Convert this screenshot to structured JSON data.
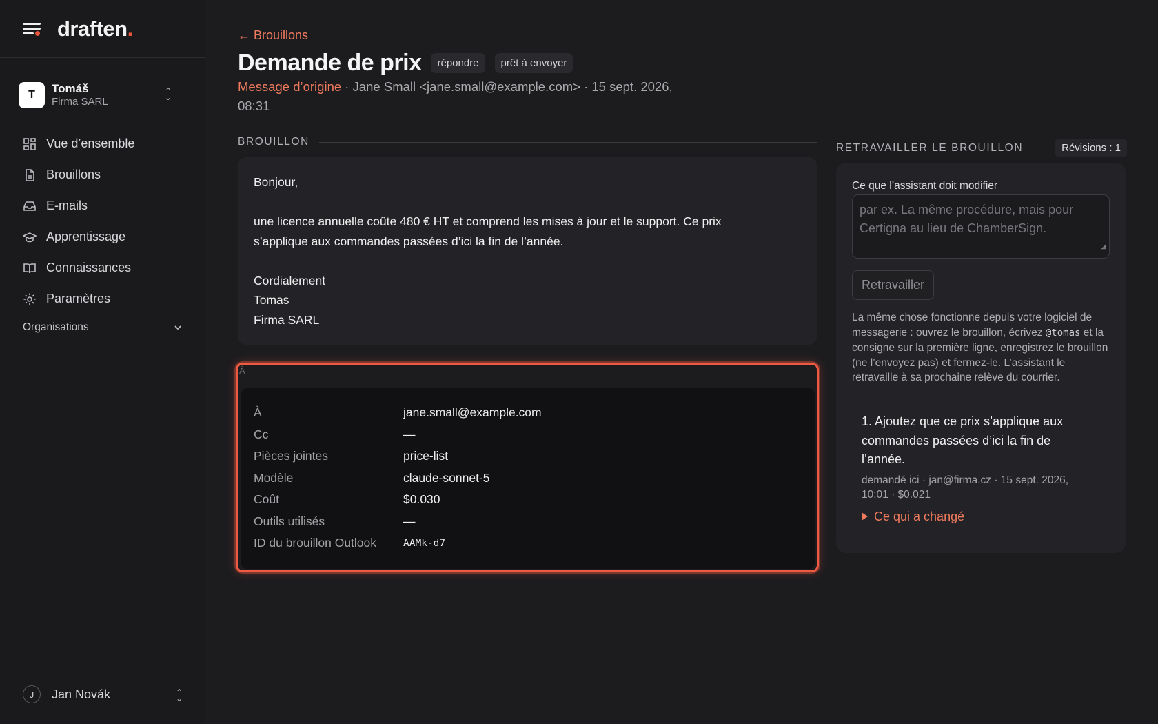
{
  "brand": {
    "logo_text": "draften",
    "logo_dot": "."
  },
  "org": {
    "initial": "T",
    "name": "Tomáš",
    "company": "Firma SARL"
  },
  "nav": [
    {
      "label": "Vue d’ensemble",
      "icon": "grid-icon"
    },
    {
      "label": "Brouillons",
      "icon": "document-icon"
    },
    {
      "label": "E-mails",
      "icon": "inbox-icon"
    },
    {
      "label": "Apprentissage",
      "icon": "graduation-cap-icon"
    },
    {
      "label": "Connaissances",
      "icon": "book-icon"
    },
    {
      "label": "Paramètres",
      "icon": "gear-icon"
    }
  ],
  "organisations_label": "Organisations",
  "user": {
    "initial": "J",
    "name": "Jan Novák"
  },
  "page": {
    "back_label": "← Brouillons",
    "title": "Demande de prix",
    "chips": [
      "répondre",
      "prêt à envoyer"
    ],
    "origin_link": "Message d’origine",
    "origin_meta": " · Jane Small <jane.small@example.com> · 15 sept. 2026, 08:31"
  },
  "draft": {
    "section_label": "BROUILLON",
    "greeting": "Bonjour,",
    "body_line1": "une licence annuelle coûte 480 € HT et comprend les mises à jour et le support. Ce prix",
    "body_line2": "s’applique aux commandes passées d’ici la fin de l’année.",
    "closing": "Cordialement",
    "sign_name": "Tomas",
    "sign_company": "Firma SARL"
  },
  "details": {
    "corner_label": "À",
    "rows": [
      {
        "key": "À",
        "value": "jane.small@example.com"
      },
      {
        "key": "Cc",
        "value": "—"
      },
      {
        "key": "Pièces jointes",
        "value": "price-list"
      },
      {
        "key": "Modèle",
        "value": "claude-sonnet-5"
      },
      {
        "key": "Coût",
        "value": "$0.030"
      },
      {
        "key": "Outils utilisés",
        "value": "—"
      },
      {
        "key": "ID du brouillon Outlook",
        "value": "AAMk-d7"
      }
    ]
  },
  "rework": {
    "section_label": "RETRAVAILLER LE BROUILLON",
    "revisions": "Révisions : 1",
    "field_label": "Ce que l’assistant doit modifier",
    "placeholder": "par ex. La même procédure, mais pour Certigna au lieu de ChamberSign.",
    "button": "Retravailler",
    "help_before": "La même chose fonctionne depuis votre logiciel de messagerie : ouvrez le brouillon, écrivez ",
    "help_code": "@tomas",
    "help_after": " et la consigne sur la première ligne, enregistrez le brouillon (ne l’envoyez pas) et fermez-le. L’assistant le retravaille à sa prochaine relève du courrier.",
    "revision_item": {
      "text": "1. Ajoutez que ce prix s’applique aux commandes passées d’ici la fin de l’année.",
      "meta": "demandé ici · jan@firma.cz · 15 sept. 2026, 10:01 · $0.021",
      "toggle": "Ce qui a changé"
    }
  },
  "colors": {
    "accent": "#e8553a",
    "link": "#f07a5e",
    "background": "#1c1c1f",
    "card": "#232327"
  }
}
